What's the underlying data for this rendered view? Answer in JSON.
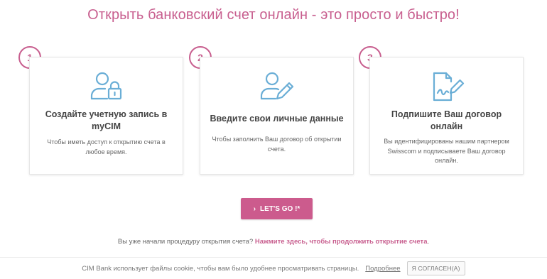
{
  "headline": "Открыть банковский счет онлайн - это просто и быстро!",
  "steps": [
    {
      "number": "1",
      "icon": "user-lock-icon",
      "title": "Создайте учетную запись в myCIM",
      "text": "Чтобы иметь доступ к открытию счета в любое время."
    },
    {
      "number": "2",
      "icon": "user-edit-icon",
      "title": "Введите свои личные данные",
      "text": "Чтобы заполнить Ваш договор об открытии счета."
    },
    {
      "number": "3",
      "icon": "document-sign-icon",
      "title": "Подпишите Ваш договор онлайн",
      "text": "Вы идентифицированы нашим партнером Swisscom и подписываете Ваш договор онлайн."
    }
  ],
  "cta": {
    "chevron": "›",
    "label": "LET'S GO !*"
  },
  "resume": {
    "prefix": "Вы уже начали процедуру открытия счета? ",
    "link": "Нажмите здесь, чтобы продолжить открытие счета",
    "suffix": "."
  },
  "cookie": {
    "text": "CIM Bank использует файлы cookie, чтобы вам было удобнее просматривать страницы.",
    "more_link": "Подробнее",
    "accept_button": "Я СОГЛАСЕН(А)"
  },
  "colors": {
    "accent": "#c85f8f",
    "button": "#cc5b8d",
    "icon": "#6aaed6"
  }
}
